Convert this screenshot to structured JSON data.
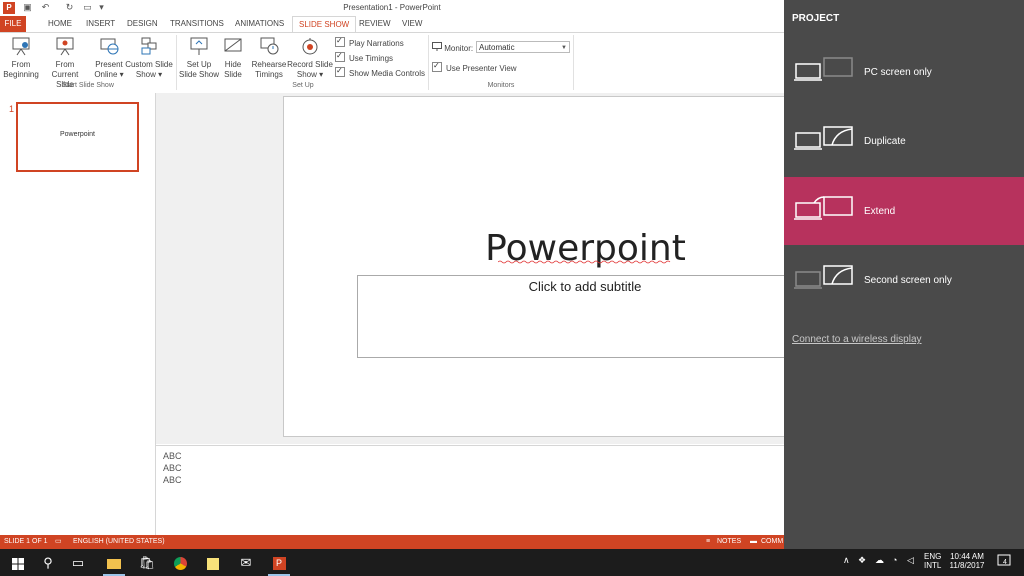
{
  "window": {
    "title": "Presentation1 - PowerPoint",
    "app_icon": "P"
  },
  "tabs": [
    "FILE",
    "HOME",
    "INSERT",
    "DESIGN",
    "TRANSITIONS",
    "ANIMATIONS",
    "SLIDE SHOW",
    "REVIEW",
    "VIEW"
  ],
  "ribbon": {
    "from_beginning": [
      "From",
      "Beginning"
    ],
    "from_current": [
      "From",
      "Current Slide"
    ],
    "present_online": [
      "Present",
      "Online ▾"
    ],
    "custom_show": [
      "Custom Slide",
      "Show ▾"
    ],
    "group_start": "Start Slide Show",
    "setup_show": [
      "Set Up",
      "Slide Show"
    ],
    "hide_slide": [
      "Hide",
      "Slide"
    ],
    "rehearse": [
      "Rehearse",
      "Timings"
    ],
    "record": [
      "Record Slide",
      "Show ▾"
    ],
    "play_narrations": "Play Narrations",
    "use_timings": "Use Timings",
    "show_media": "Show Media Controls",
    "group_setup": "Set Up",
    "monitor_label": "Monitor:",
    "monitor_value": "Automatic",
    "presenter_view": "Use Presenter View",
    "group_monitors": "Monitors"
  },
  "thumbnail": {
    "number": "1",
    "text": "Powerpoint"
  },
  "slide": {
    "title": "Powerpoint",
    "subtitle_placeholder": "Click to add subtitle"
  },
  "notes": [
    "ABC",
    "ABC",
    "ABC"
  ],
  "status": {
    "slide": "SLIDE 1 OF 1",
    "language": "ENGLISH (UNITED STATES)",
    "notes": "NOTES",
    "comments": "COMM"
  },
  "project_panel": {
    "title": "PROJECT",
    "options": [
      "PC screen only",
      "Duplicate",
      "Extend",
      "Second screen only"
    ],
    "selected": "Extend",
    "wireless_link": "Connect to a wireless display"
  },
  "taskbar": {
    "lang1": "ENG",
    "lang2": "INTL",
    "time": "10:44 AM",
    "date": "11/8/2017",
    "notif_count": "4"
  },
  "colors": {
    "accent": "#d04423",
    "panel": "#4a4a4a",
    "selected": "#b7325d",
    "taskbar": "#1c1c1c"
  }
}
